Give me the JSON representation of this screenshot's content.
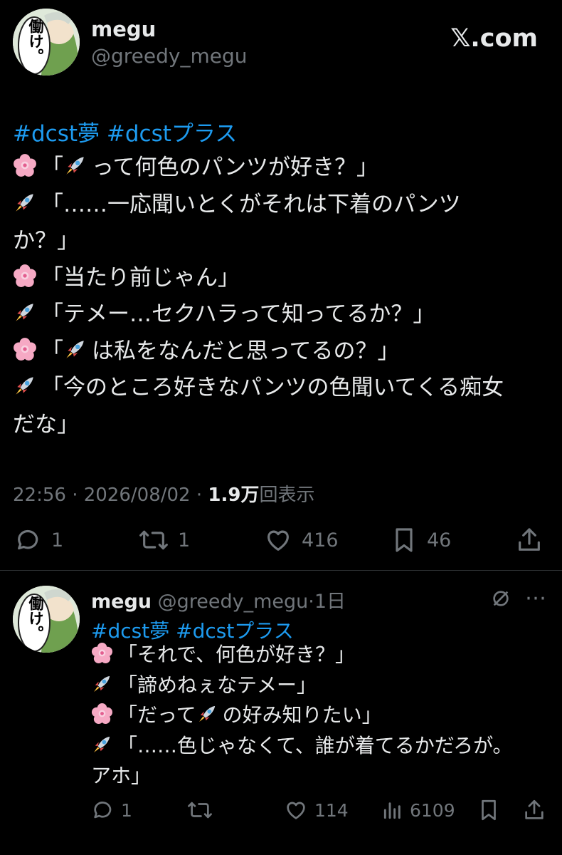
{
  "main": {
    "author_name": "megu",
    "author_handle": "@greedy_megu",
    "brand": "𝕏.com",
    "avatar_text": "働け。",
    "tags": [
      "#dcst夢",
      "#dcstプラス"
    ],
    "lines": [
      {
        "emoji": "flower",
        "text": "「"
      },
      {
        "emoji": "rocket",
        "text": "「……一応聞いとくがそれは下着のパンツ"
      },
      {
        "emoji": "",
        "text": "か？」"
      },
      {
        "emoji": "flower",
        "text": "「当たり前じゃん」"
      },
      {
        "emoji": "rocket",
        "text": "「テメー…セクハラって知ってるか？」"
      },
      {
        "emoji": "flower",
        "text": "「"
      },
      {
        "emoji": "rocket",
        "text": "「今のところ好きなパンツの色聞いてくる痴女"
      },
      {
        "emoji": "",
        "text": "だな」"
      }
    ],
    "line1_after": "って何色のパンツが好き？」",
    "line6_after": "は私をなんだと思ってるの？」",
    "time": "22:56 · 2026/08/02 · ",
    "views_number": "1.9万",
    "views_label": "回表示",
    "stats": {
      "replies": "1",
      "reposts": "1",
      "likes": "416",
      "bookmarks": "46"
    }
  },
  "reply": {
    "author_name": "megu",
    "author_handle": "@greedy_megu",
    "age": "·1日",
    "tags": [
      "#dcst夢",
      "#dcstプラス"
    ],
    "lines": [
      {
        "emoji": "flower",
        "text": "「それで、何色が好き？」"
      },
      {
        "emoji": "rocket",
        "text": "「諦めねぇなテメー」"
      },
      {
        "emoji": "flower",
        "text": "「だって"
      },
      {
        "emoji": "rocket",
        "text": "「……色じゃなくて、誰が着てるかだろが。"
      },
      {
        "emoji": "",
        "text": "アホ」"
      }
    ],
    "line3_after": "の好み知りたい」",
    "stats": {
      "replies": "1",
      "likes": "114",
      "views": "6109"
    }
  },
  "icons": [
    "reply-icon",
    "repost-icon",
    "like-icon",
    "bookmark-icon",
    "share-icon",
    "views-icon",
    "no-grok-icon",
    "flower-emoji",
    "rocket-emoji"
  ],
  "colors": {
    "background": "#000000",
    "text": "#e7e9ea",
    "muted": "#71767b",
    "link": "#1d9bf0"
  }
}
